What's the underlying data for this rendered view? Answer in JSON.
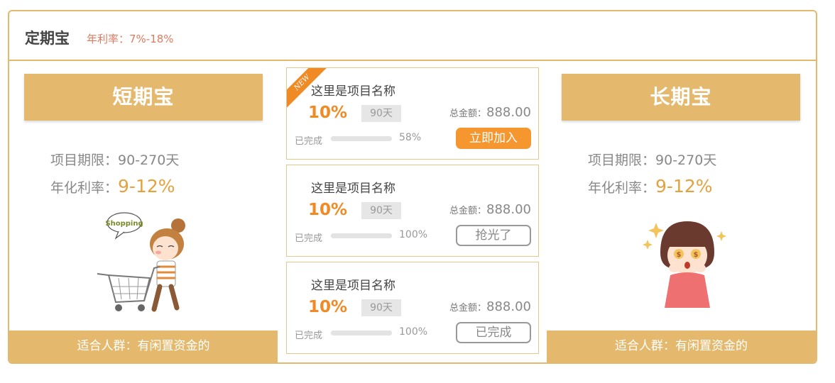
{
  "header": {
    "title": "定期宝",
    "rate": "年利率：7%-18%"
  },
  "left_panel": {
    "title": "短期宝",
    "period_label": "项目期限：",
    "period_value": "90-270天",
    "rate_label": "年化利率：",
    "rate_value": "9-12%",
    "footer": "适合人群：有闲置资金的",
    "illustration": "shopping-girl"
  },
  "right_panel": {
    "title": "长期宝",
    "period_label": "项目期限：",
    "period_value": "90-270天",
    "rate_label": "年化利率：",
    "rate_value": "9-12%",
    "footer": "适合人群：有闲置资金的",
    "illustration": "money-eyes-girl"
  },
  "projects": [
    {
      "badge": "NEW",
      "name": "这里是项目名称",
      "rate": "10%",
      "days": "90天",
      "total_label": "总金额：",
      "total_value": "888.00",
      "done_label": "已完成",
      "progress": 58,
      "progress_text": "58%",
      "button": "立即加入",
      "button_style": "join"
    },
    {
      "name": "这里是项目名称",
      "rate": "10%",
      "days": "90天",
      "total_label": "总金额：",
      "total_value": "888.00",
      "done_label": "已完成",
      "progress": 100,
      "progress_text": "100%",
      "button": "抢光了",
      "button_style": "grey"
    },
    {
      "name": "这里是项目名称",
      "rate": "10%",
      "days": "90天",
      "total_label": "总金额：",
      "total_value": "888.00",
      "done_label": "已完成",
      "progress": 100,
      "progress_text": "100%",
      "button": "已完成",
      "button_style": "grey"
    }
  ],
  "colors": {
    "accent": "#e4b96e",
    "orange": "#f08a24",
    "button": "#f6962f",
    "rate": "#e4a23e"
  }
}
